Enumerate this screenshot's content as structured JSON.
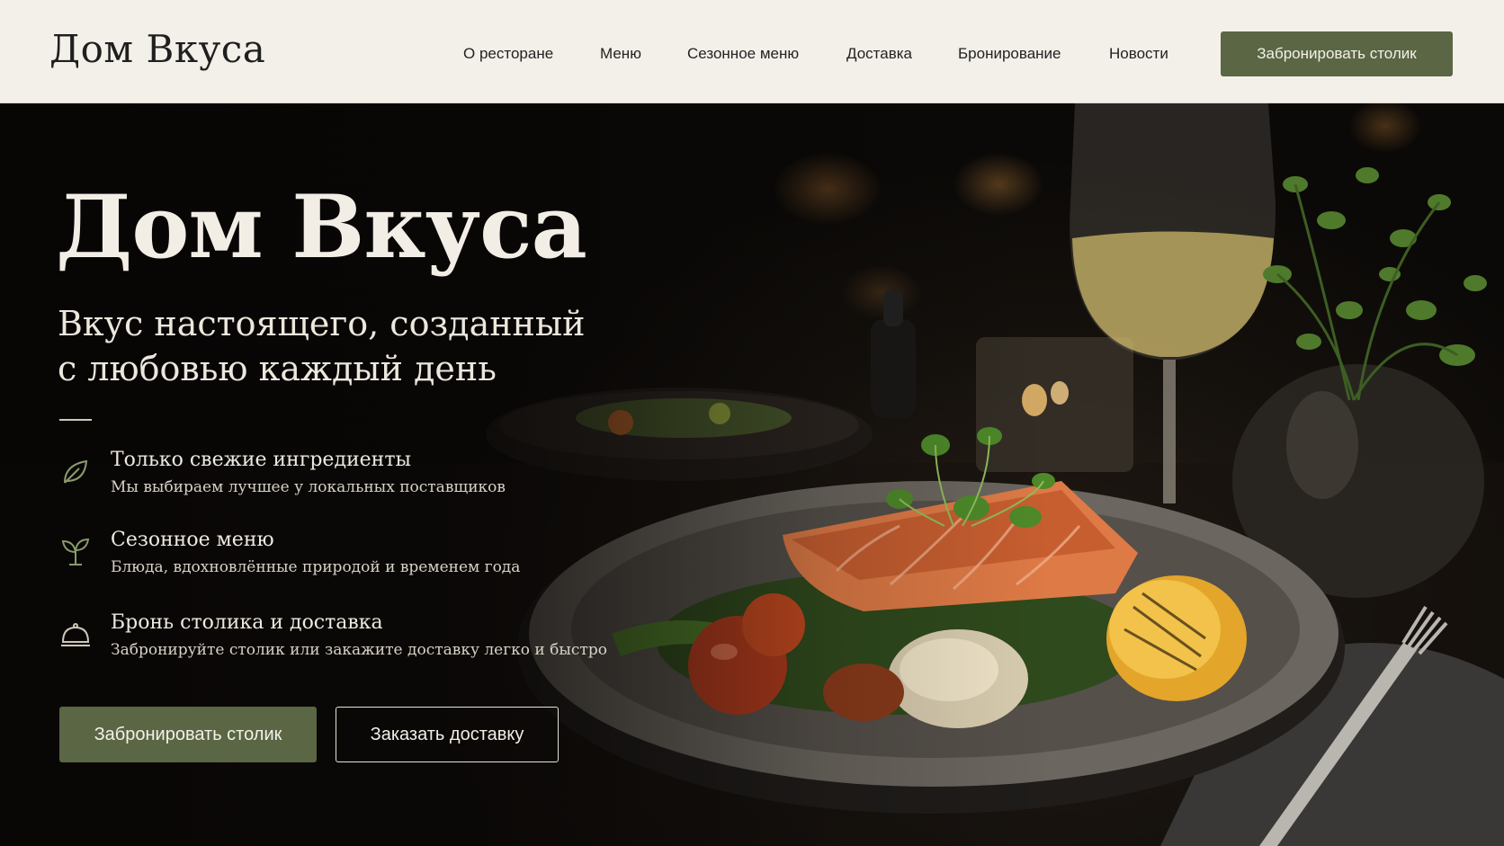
{
  "header": {
    "logo": "Дом Вкуса",
    "nav": [
      {
        "label": "О ресторане"
      },
      {
        "label": "Меню"
      },
      {
        "label": "Сезонное меню"
      },
      {
        "label": "Доставка"
      },
      {
        "label": "Бронирование"
      },
      {
        "label": "Новости"
      }
    ],
    "cta_label": "Забронировать столик"
  },
  "hero": {
    "title": "Дом Вкуса",
    "subtitle_line1": "Вкус настоящего, созданный",
    "subtitle_line2": "с любовью каждый день",
    "features": [
      {
        "icon": "leaf-icon",
        "title": "Только свежие ингредиенты",
        "desc": "Мы выбираем лучшее у локальных поставщиков"
      },
      {
        "icon": "sprout-icon",
        "title": "Сезонное меню",
        "desc": "Блюда, вдохновлённые природой и временем года"
      },
      {
        "icon": "cloche-icon",
        "title": "Бронь столика и доставка",
        "desc": "Забронируйте столик или закажите доставку легко и быстро"
      }
    ],
    "primary_button": "Забронировать столик",
    "secondary_button": "Заказать доставку"
  },
  "colors": {
    "accent": "#5a6644",
    "header_bg": "#f3f0e9",
    "hero_text": "#f2eee6"
  }
}
